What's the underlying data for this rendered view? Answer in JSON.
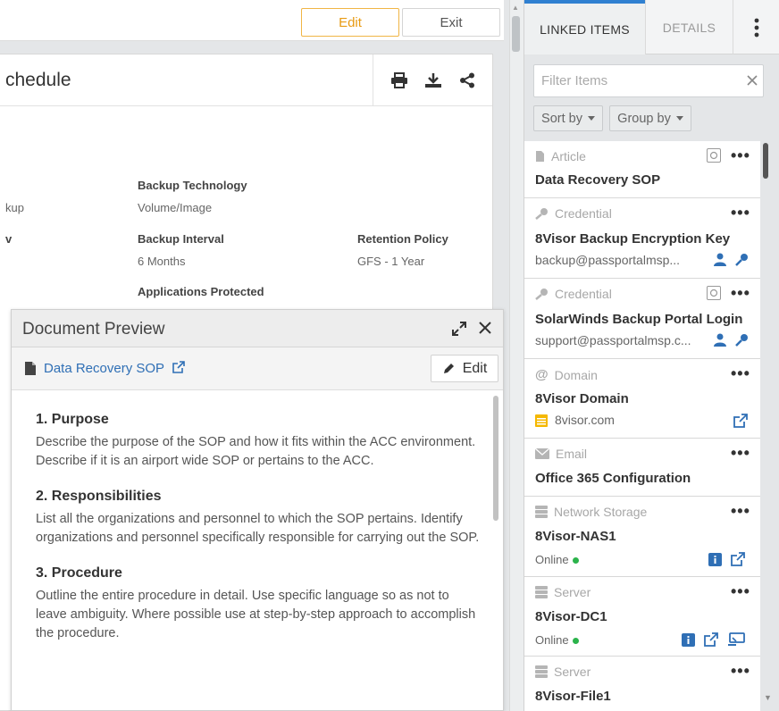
{
  "topbar": {
    "edit_label": "Edit",
    "exit_label": "Exit"
  },
  "document": {
    "title": "chedule",
    "fields": {
      "backup_technology_label": "Backup Technology",
      "backup_technology_value": "Volume/Image",
      "backup_type_partial": "kup",
      "backup_interval_label": "Backup Interval",
      "backup_interval_value": "6 Months",
      "left_label_partial": "v",
      "retention_policy_label": "Retention Policy",
      "retention_policy_value": "GFS - 1 Year",
      "applications_protected_label": "Applications Protected"
    }
  },
  "preview": {
    "title": "Document Preview",
    "doc_link": "Data Recovery SOP",
    "edit_label": "Edit",
    "sections": [
      {
        "heading": "1. Purpose",
        "text": "Describe the purpose of the SOP and how it fits within the ACC environment. Describe if it is an airport wide SOP or pertains to the ACC."
      },
      {
        "heading": "2. Responsibilities",
        "text": "List all the organizations and personnel to which the SOP pertains. Identify organizations and personnel specifically responsible for carrying out the SOP."
      },
      {
        "heading": "3. Procedure",
        "text": "Outline the entire procedure in detail. Use specific language so as not to leave ambiguity. Where possible use at step-by-step approach to accomplish the procedure."
      }
    ]
  },
  "right_panel": {
    "tabs": {
      "linked_items": "LINKED ITEMS",
      "details": "DETAILS"
    },
    "filter_placeholder": "Filter Items",
    "sort_label": "Sort by",
    "group_label": "Group by",
    "items": [
      {
        "type": "Article",
        "type_icon": "document-icon",
        "title": "Data Recovery SOP"
      },
      {
        "type": "Credential",
        "type_icon": "key-icon",
        "title": "8Visor Backup Encryption Key",
        "sub": "backup@passportalmsp..."
      },
      {
        "type": "Credential",
        "type_icon": "key-icon",
        "title": "SolarWinds Backup Portal Login",
        "sub": "support@passportalmsp.c..."
      },
      {
        "type": "Domain",
        "type_icon": "at-icon",
        "title": "8Visor Domain",
        "sub": "8visor.com"
      },
      {
        "type": "Email",
        "type_icon": "envelope-icon",
        "title": "Office 365 Configuration"
      },
      {
        "type": "Network Storage",
        "type_icon": "storage-icon",
        "title": "8Visor-NAS1",
        "status": "Online"
      },
      {
        "type": "Server",
        "type_icon": "server-icon",
        "title": "8Visor-DC1",
        "status": "Online"
      },
      {
        "type": "Server",
        "type_icon": "server-icon",
        "title": "8Visor-File1"
      }
    ]
  },
  "colors": {
    "accent_blue": "#2f80d1",
    "edit_orange": "#e89a12",
    "link_blue": "#2f6fb5",
    "online_green": "#2bb34b"
  }
}
